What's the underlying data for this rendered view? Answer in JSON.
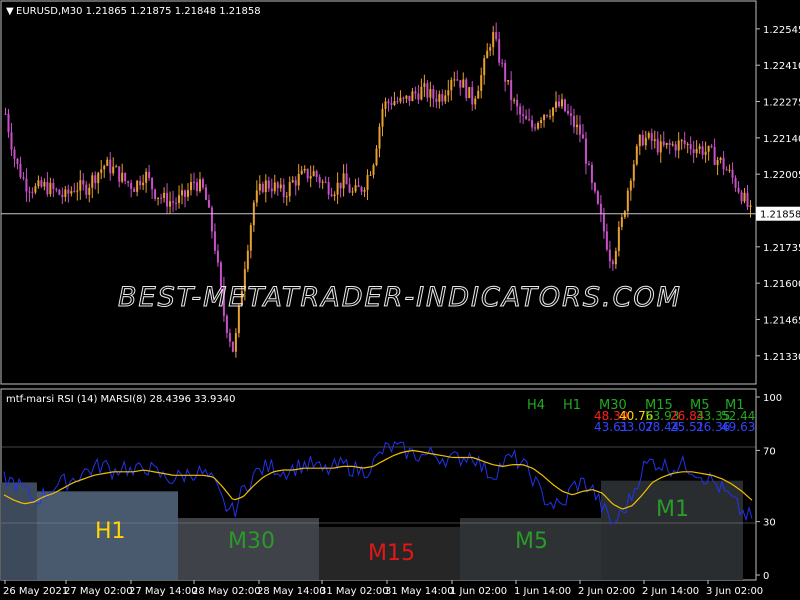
{
  "symbol_title": "EURUSD,M30  1.21865 1.21875 1.21848 1.21858",
  "dropdown_glyph": "▼",
  "watermark": "BEST-METATRADER-INDICATORS.COM",
  "price_axis": {
    "range": [
      1.2124,
      1.2263
    ],
    "ticks": [
      "1.22545",
      "1.22410",
      "1.22275",
      "1.22140",
      "1.22005",
      "1.21870",
      "1.21735",
      "1.21600",
      "1.21465",
      "1.21330"
    ],
    "current_price": "1.21858",
    "current_price_value": 1.21858
  },
  "indicator": {
    "title": "mtf-marsi  RSI (14)  MARSI(8) 28.4396 33.9340",
    "levels": [
      "100",
      "70",
      "30",
      "0"
    ],
    "timeframes": [
      "H4",
      "H1",
      "M30",
      "M15",
      "M5",
      "M1"
    ],
    "row1": [
      {
        "text": "48.39",
        "color": "#ff2020"
      },
      {
        "text": "40.76",
        "color": "#ffd700"
      },
      {
        "text": "53.93",
        "color": "#22aa22"
      },
      {
        "text": "26.84",
        "color": "#ff2020"
      },
      {
        "text": "33.35",
        "color": "#22aa22"
      },
      {
        "text": "52.44",
        "color": "#22aa22"
      }
    ],
    "row2": [
      {
        "text": "43.61",
        "color": "#3344ff"
      },
      {
        "text": "33.07",
        "color": "#3344ff"
      },
      {
        "text": "28.44",
        "color": "#3344ff"
      },
      {
        "text": "25.51",
        "color": "#3344ff"
      },
      {
        "text": "26.36",
        "color": "#3344ff"
      },
      {
        "text": "49.63",
        "color": "#3344ff"
      }
    ],
    "zones": [
      {
        "label": "H1",
        "color": "#ffd700",
        "rsi": 47
      },
      {
        "label": "M30",
        "color": "#2a9a2a",
        "rsi": 32
      },
      {
        "label": "M15",
        "color": "#e01818",
        "rsi": 27
      },
      {
        "label": "M5",
        "color": "#2a9a2a",
        "rsi": 32
      },
      {
        "label": "M1",
        "color": "#2a9a2a",
        "rsi": 53
      }
    ],
    "h4_zone_rsi": 52
  },
  "time_axis": [
    "26 May 2021",
    "27 May 02:00",
    "27 May 14:00",
    "28 May 02:00",
    "28 May 14:00",
    "31 May 02:00",
    "31 May 14:00",
    "1 Jun 02:00",
    "1 Jun 14:00",
    "2 Jun 02:00",
    "2 Jun 14:00",
    "3 Jun 02:00"
  ],
  "colors": {
    "bull": "#e8a030",
    "bear": "#c850c8",
    "rsi_line": "#2233ee",
    "marsi_line": "#f0c000",
    "grid": "#888888"
  },
  "price_path": [
    1.2223,
    1.2205,
    1.2197,
    1.2195,
    1.2196,
    1.2194,
    1.2192,
    1.2196,
    1.2195,
    1.22,
    1.2204,
    1.2202,
    1.2198,
    1.2196,
    1.2201,
    1.2194,
    1.2191,
    1.219,
    1.2192,
    1.2198,
    1.2194,
    1.2176,
    1.2148,
    1.2134,
    1.2165,
    1.219,
    1.2197,
    1.2196,
    1.2193,
    1.2198,
    1.22,
    1.2201,
    1.2197,
    1.2195,
    1.2198,
    1.2193,
    1.2196,
    1.2205,
    1.2226,
    1.2228,
    1.2227,
    1.223,
    1.2232,
    1.2229,
    1.223,
    1.2238,
    1.2234,
    1.2228,
    1.2238,
    1.2253,
    1.224,
    1.2228,
    1.2221,
    1.2218,
    1.2223,
    1.2225,
    1.2226,
    1.222,
    1.2215,
    1.2196,
    1.2183,
    1.2168,
    1.2182,
    1.2202,
    1.2214,
    1.2213,
    1.221,
    1.2211,
    1.2212,
    1.2211,
    1.221,
    1.2208,
    1.2205,
    1.22,
    1.2194,
    1.2186
  ],
  "rsi_path": [
    54,
    52,
    48,
    42,
    45,
    50,
    52,
    54,
    58,
    60,
    62,
    58,
    62,
    56,
    62,
    58,
    55,
    54,
    56,
    58,
    57,
    52,
    40,
    35,
    48,
    56,
    60,
    61,
    58,
    60,
    62,
    62,
    58,
    60,
    62,
    60,
    58,
    62,
    70,
    72,
    70,
    68,
    67,
    68,
    66,
    65,
    66,
    68,
    60,
    56,
    63,
    66,
    62,
    55,
    44,
    40,
    38,
    50,
    52,
    48,
    38,
    28,
    35,
    45,
    60,
    64,
    62,
    60,
    62,
    60,
    56,
    53,
    48,
    42,
    35,
    32
  ],
  "marsi_path": [
    45,
    42,
    40,
    41,
    44,
    46,
    49,
    52,
    54,
    56,
    57,
    58,
    58,
    58,
    59,
    58,
    57,
    56,
    56,
    56,
    56,
    55,
    49,
    42,
    44,
    50,
    55,
    58,
    59,
    59,
    60,
    60,
    60,
    60,
    61,
    61,
    60,
    61,
    64,
    67,
    69,
    70,
    69,
    68,
    67,
    66,
    66,
    66,
    64,
    62,
    61,
    62,
    62,
    60,
    56,
    51,
    47,
    45,
    47,
    48,
    46,
    40,
    37,
    39,
    45,
    52,
    55,
    57,
    58,
    58,
    57,
    56,
    54,
    51,
    47,
    42
  ]
}
